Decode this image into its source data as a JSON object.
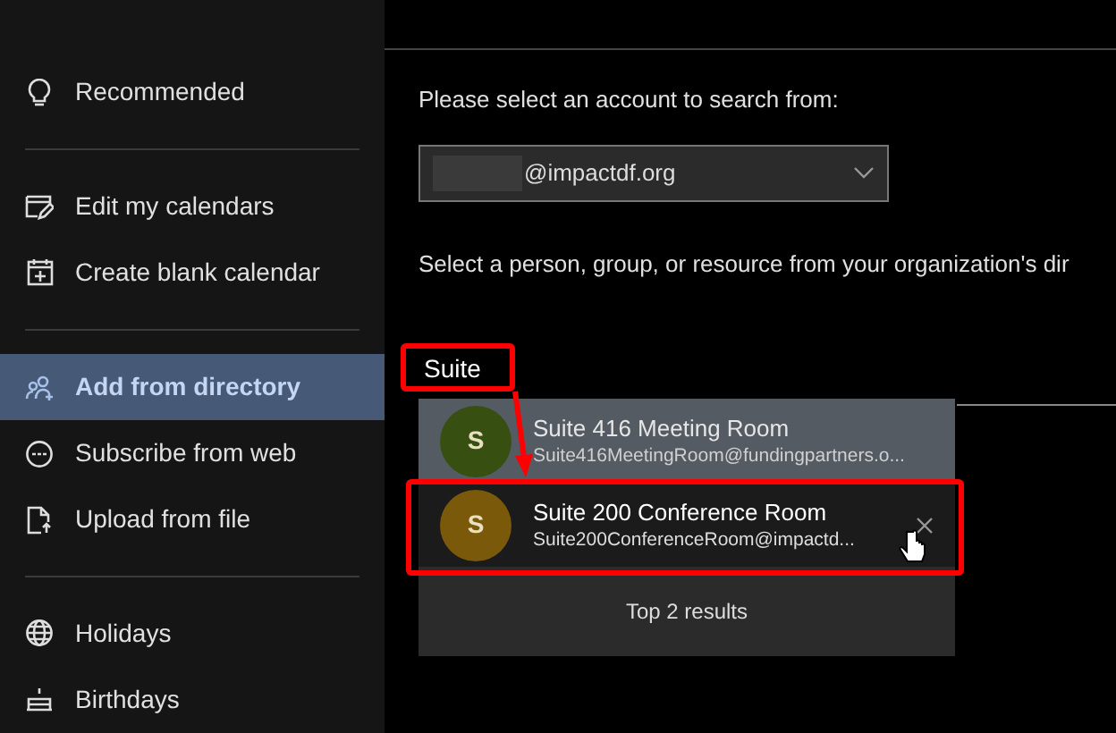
{
  "sidebar": {
    "items": [
      {
        "kind": "item",
        "label": "Recommended",
        "selected": false
      },
      {
        "kind": "divider"
      },
      {
        "kind": "item",
        "label": "Edit my calendars",
        "selected": false
      },
      {
        "kind": "item",
        "label": "Create blank calendar",
        "selected": false
      },
      {
        "kind": "divider"
      },
      {
        "kind": "item",
        "label": "Add from directory",
        "selected": true
      },
      {
        "kind": "item",
        "label": "Subscribe from web",
        "selected": false
      },
      {
        "kind": "item",
        "label": "Upload from file",
        "selected": false
      },
      {
        "kind": "divider"
      },
      {
        "kind": "item",
        "label": "Holidays",
        "selected": false
      },
      {
        "kind": "item",
        "label": "Birthdays",
        "selected": false
      }
    ]
  },
  "main": {
    "account_prompt": "Please select an account to search from:",
    "account": {
      "value": "@impactdf.org"
    },
    "directory_prompt": "Select a person, group, or resource from your organization's dir",
    "search": {
      "value": "Suite"
    },
    "results": [
      {
        "initial": "S",
        "color": "#375012",
        "name": "Suite 416 Meeting Room",
        "email": "Suite416MeetingRoom@fundingpartners.o...",
        "selected": true,
        "remove_shown": false
      },
      {
        "initial": "S",
        "color": "#7a5a0a",
        "name": "Suite 200 Conference Room",
        "email": "Suite200ConferenceRoom@impactd...",
        "selected": false,
        "remove_shown": true
      }
    ],
    "results_footer": "Top 2 results"
  }
}
